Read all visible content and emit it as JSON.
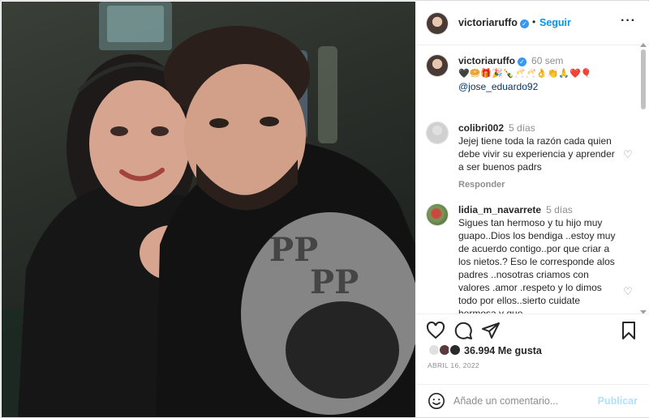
{
  "post": {
    "photo_description_icon": "photo-icon"
  },
  "header": {
    "username": "victoriaruffo",
    "verified_icon": "verified-badge-icon",
    "separator": "•",
    "follow_label": "Seguir",
    "more_icon": "more-options-icon"
  },
  "caption": {
    "username": "victoriaruffo",
    "time": "60 sem",
    "emojis": "🖤🥯🎁🎉🍾🥂🥂👌👏🙏❤️🎈",
    "mention": "@jose_eduardo92"
  },
  "comments": [
    {
      "username": "colibri002",
      "time": "5 días",
      "text": "Jejej tiene toda la razón cada quien debe vivir su experiencia y aprender a ser buenos padrs",
      "reply_label": "Responder"
    },
    {
      "username": "lidia_m_navarrete",
      "time": "5 días",
      "text": "Sigues tan hermoso y tu hijo muy guapo..Dios los bendiga ..estoy muy de acuerdo contigo..por que criar a los nietos.? Eso le corresponde alos padres ..nosotras criamos con valores .amor .respeto y lo dimos todo por ellos..sierto cuidate hermosa y que"
    }
  ],
  "actions": {
    "like_icon": "heart-icon",
    "comment_icon": "comment-icon",
    "share_icon": "send-icon",
    "save_icon": "bookmark-icon"
  },
  "likes": {
    "count_text": "36.994 Me gusta"
  },
  "date": "ABRIL 16, 2022",
  "add_comment": {
    "emoji_icon": "emoji-icon",
    "placeholder": "Añade un comentario...",
    "publish_label": "Publicar"
  },
  "colors": {
    "accent": "#0095f6",
    "verified": "#3897f0",
    "muted": "#8e8e8e",
    "publish_disabled": "#b2dffc"
  }
}
